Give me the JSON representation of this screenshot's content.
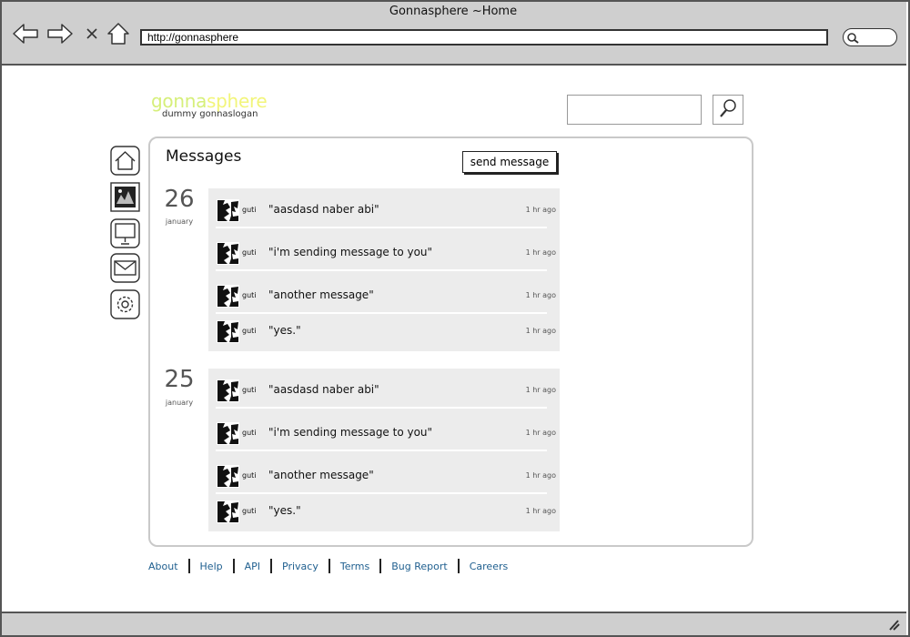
{
  "window": {
    "title": "Gonnasphere ~Home"
  },
  "browser": {
    "url": "http://gonnasphere",
    "nav_icons": [
      "back-arrow-icon",
      "forward-arrow-icon",
      "close-x-icon",
      "home-icon"
    ],
    "search_icon": "magnifier-icon"
  },
  "header": {
    "logo_prefix": "gonna",
    "logo_suffix": "sphere",
    "slogan": "dummy gonnaslogan",
    "search_placeholder": "",
    "search_icon": "magnifier-icon",
    "logo_color": "#d6ef7a",
    "logo_suffix_color": "#f2f57a"
  },
  "sidebar": {
    "items": [
      {
        "icon": "home-icon",
        "selected": false
      },
      {
        "icon": "photo-icon",
        "selected": true
      },
      {
        "icon": "presentation-icon",
        "selected": false
      },
      {
        "icon": "mail-icon",
        "selected": false
      },
      {
        "icon": "gear-icon",
        "selected": false
      }
    ]
  },
  "main": {
    "title": "Messages",
    "send_button_label": "send message",
    "days": [
      {
        "day": "26",
        "month": "january",
        "messages": [
          {
            "user": "guti",
            "text": "\"aasdasd naber abi\"",
            "time": "1 hr ago"
          },
          {
            "user": "guti",
            "text": "\"i'm sending message to you\"",
            "time": "1 hr ago"
          },
          {
            "user": "guti",
            "text": "\"another message\"",
            "time": "1 hr ago"
          },
          {
            "user": "guti",
            "text": "\"yes.\"",
            "time": "1 hr ago"
          }
        ]
      },
      {
        "day": "25",
        "month": "january",
        "messages": [
          {
            "user": "guti",
            "text": "\"aasdasd naber abi\"",
            "time": "1 hr ago"
          },
          {
            "user": "guti",
            "text": "\"i'm sending message to you\"",
            "time": "1 hr ago"
          },
          {
            "user": "guti",
            "text": "\"another message\"",
            "time": "1 hr ago"
          },
          {
            "user": "guti",
            "text": "\"yes.\"",
            "time": "1 hr ago"
          }
        ]
      }
    ]
  },
  "footer": {
    "links": [
      "About",
      "Help",
      "API",
      "Privacy",
      "Terms",
      "Bug Report",
      "Careers"
    ],
    "link_color": "#1f5f8f"
  }
}
